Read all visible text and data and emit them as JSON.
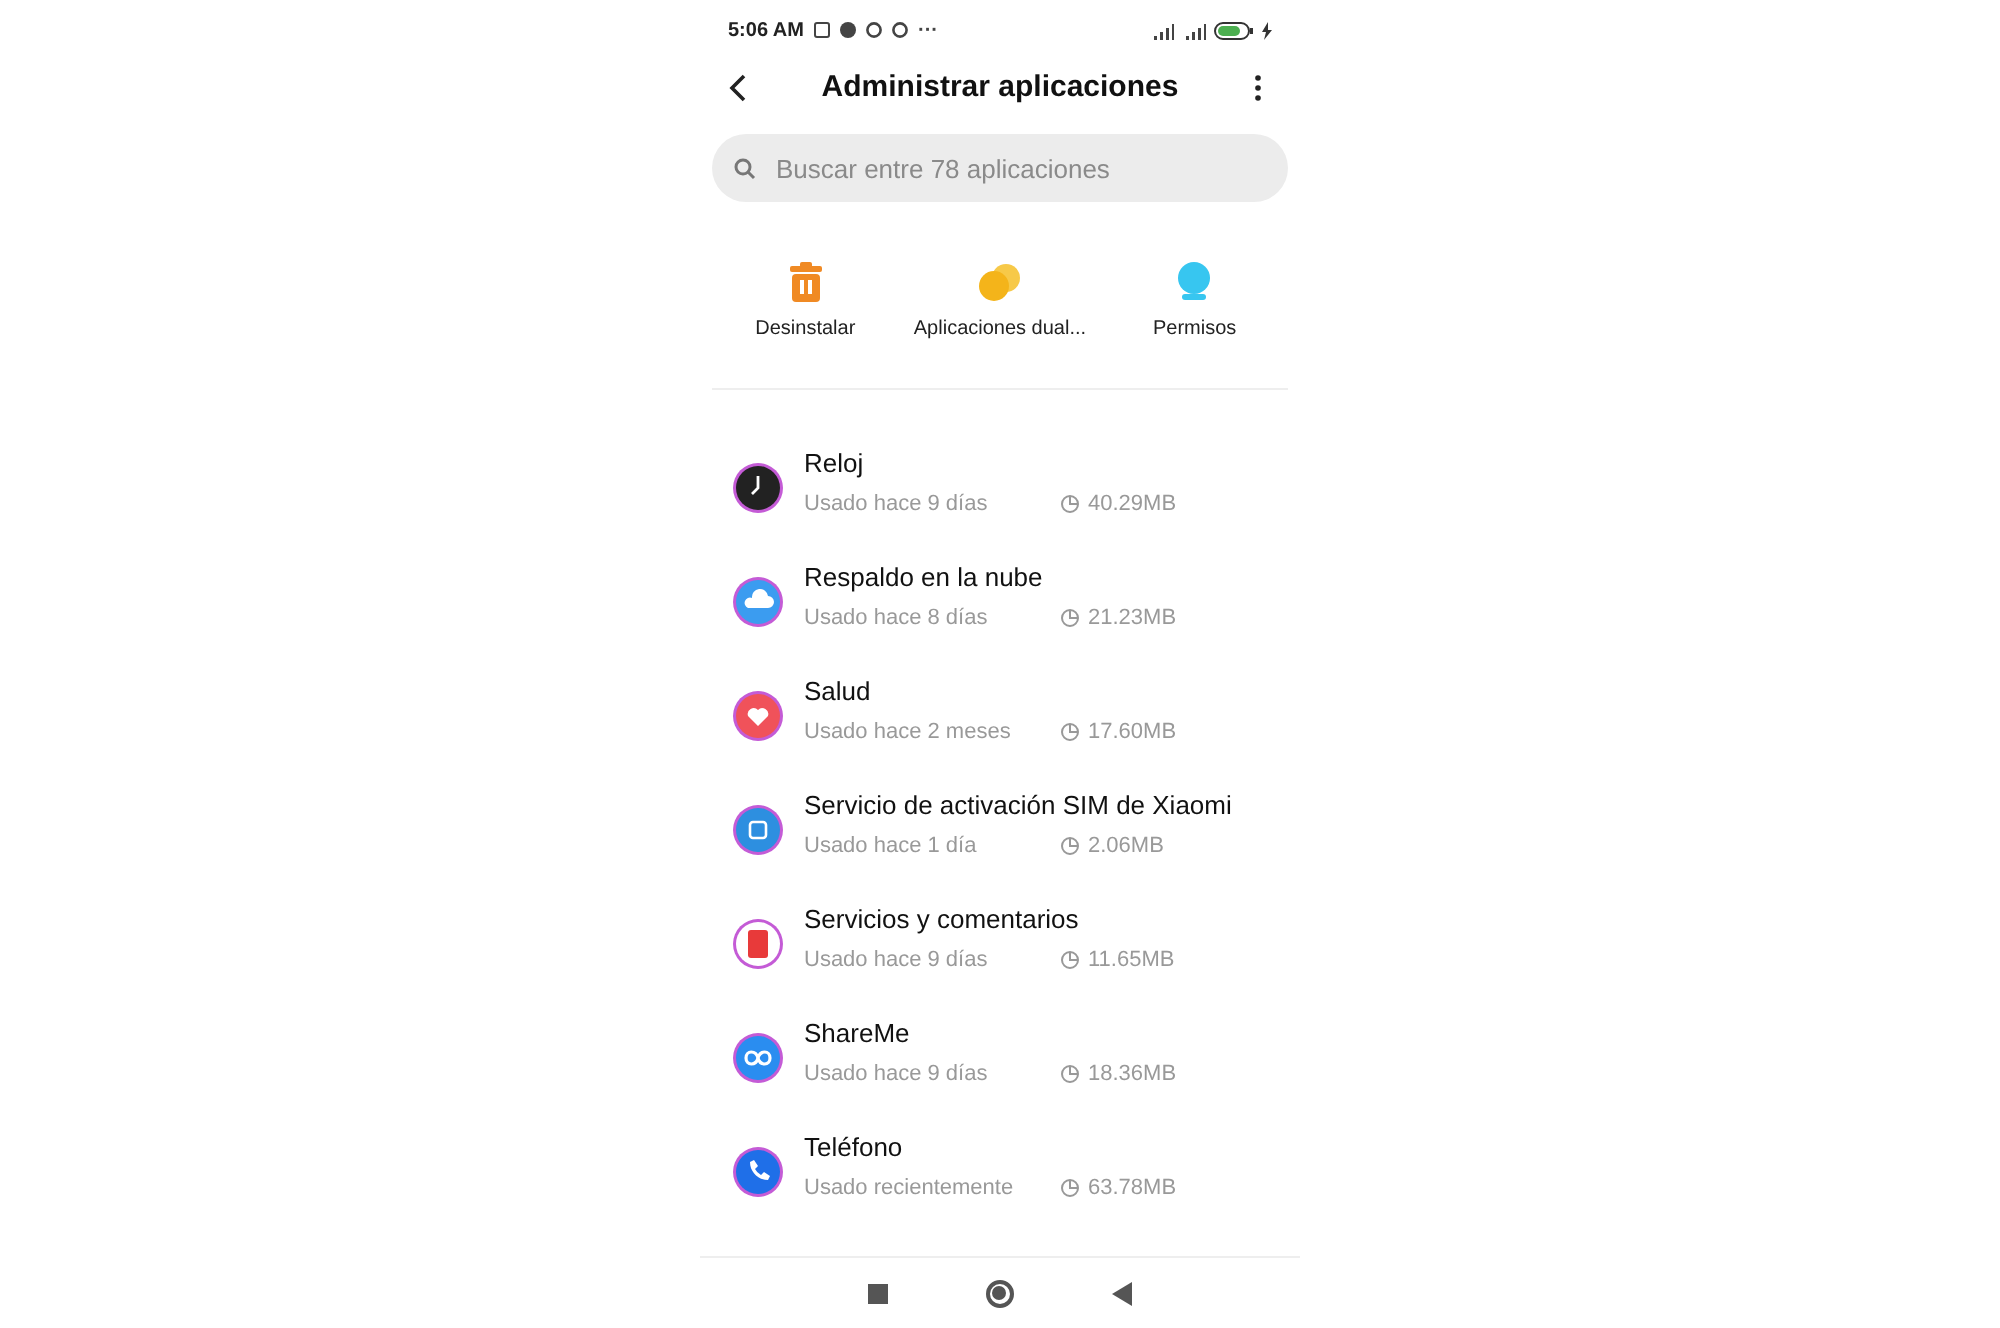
{
  "status_bar": {
    "time": "5:06 AM",
    "more": "···"
  },
  "header": {
    "title": "Administrar aplicaciones"
  },
  "search": {
    "placeholder": "Buscar entre 78 aplicaciones"
  },
  "actions": [
    {
      "kind": "trash",
      "label": "Desinstalar"
    },
    {
      "kind": "dual",
      "label": "Aplicaciones dual..."
    },
    {
      "kind": "permissions",
      "label": "Permisos"
    }
  ],
  "apps": [
    {
      "kind": "clock",
      "name": "Reloj",
      "usage": "Usado hace 9 días",
      "size": "40.29MB"
    },
    {
      "kind": "cloud",
      "name": "Respaldo en la nube",
      "usage": "Usado hace 8 días",
      "size": "21.23MB"
    },
    {
      "kind": "health",
      "name": "Salud",
      "usage": "Usado hace 2 meses",
      "size": "17.60MB"
    },
    {
      "kind": "sim",
      "name": "Servicio de activación SIM de Xiaomi",
      "usage": "Usado hace 1 día",
      "size": "2.06MB"
    },
    {
      "kind": "feedback",
      "name": "Servicios y comentarios",
      "usage": "Usado hace 9 días",
      "size": "11.65MB"
    },
    {
      "kind": "shareme",
      "name": "ShareMe",
      "usage": "Usado hace 9 días",
      "size": "18.36MB"
    },
    {
      "kind": "phone",
      "name": "Teléfono",
      "usage": "Usado recientemente",
      "size": "63.78MB"
    }
  ]
}
